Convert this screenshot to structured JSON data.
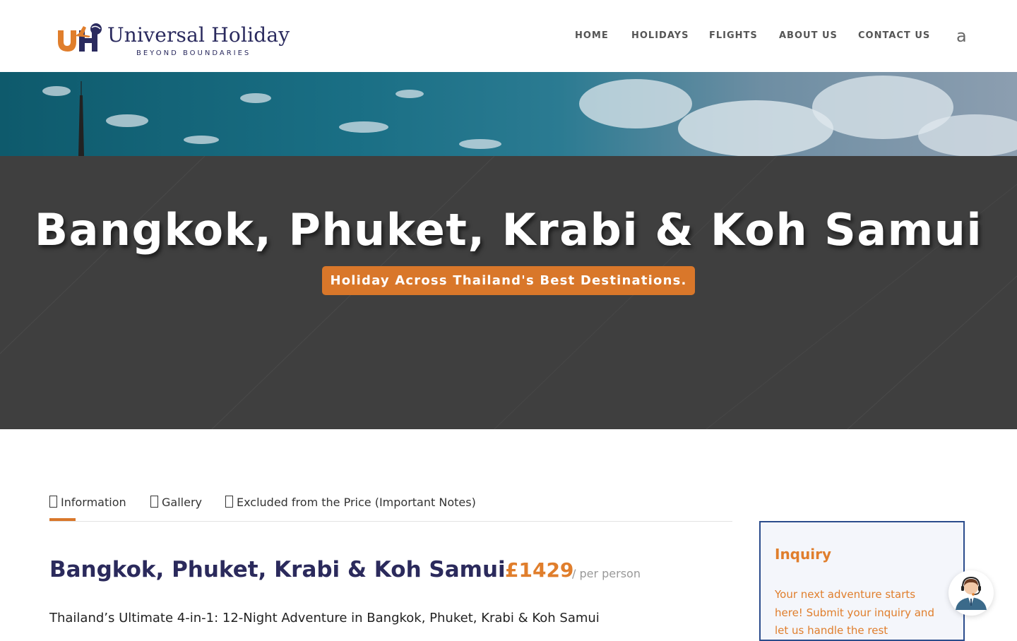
{
  "brand": {
    "name": "Universal Holiday",
    "tagline": "BEYOND BOUNDARIES",
    "colors": {
      "navy": "#2a2a5e",
      "orange": "#e07e2c"
    }
  },
  "nav": {
    "items": [
      "HOME",
      "HOLIDAYS",
      "FLIGHTS",
      "ABOUT US",
      "CONTACT US"
    ],
    "search_glyph": "a"
  },
  "hero": {
    "title": "Bangkok, Phuket, Krabi & Koh Samui",
    "subtitle": "Holiday Across Thailand's Best Destinations."
  },
  "tabs": [
    {
      "label": "Information",
      "icon": "info-icon",
      "active": true
    },
    {
      "label": "Gallery",
      "icon": "gallery-icon",
      "active": false
    },
    {
      "label": "Excluded from the Price (Important Notes)",
      "icon": "notes-icon",
      "active": false
    }
  ],
  "package": {
    "title": "Bangkok, Phuket, Krabi & Koh Samui",
    "price": "£1429",
    "price_unit": "/ per person",
    "description": "Thailand’s Ultimate 4-in-1: 12-Night Adventure in Bangkok, Phuket, Krabi & Koh Samui"
  },
  "inquiry": {
    "title": "Inquiry",
    "text": "Your next adventure starts here! Submit your inquiry and let us handle the rest"
  }
}
